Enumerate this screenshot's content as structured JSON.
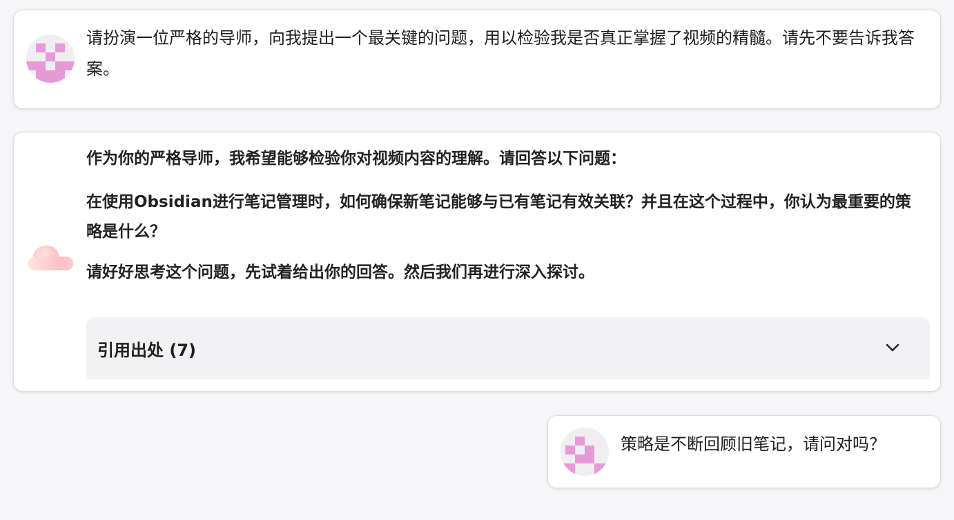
{
  "messages": {
    "user1": {
      "text": "请扮演一位严格的导师，向我提出一个最关键的问题，用以检验我是否真正掌握了视频的精髓。请先不要告诉我答案。"
    },
    "assistant": {
      "paragraphs": [
        "作为你的严格导师，我希望能够检验你对视频内容的理解。请回答以下问题：",
        "在使用Obsidian进行笔记管理时，如何确保新笔记能够与已有笔记有效关联？并且在这个过程中，你认为最重要的策略是什么？",
        "请好好思考这个问题，先试着给出你的回答。然后我们再进行深入探讨。"
      ],
      "citations_label": "引用出处 (7)",
      "citations_icon": "chevron-down-icon"
    },
    "user2": {
      "text": "策略是不断回顾旧笔记，请问对吗？"
    }
  },
  "colors": {
    "avatar_pixel": "#e79ad8",
    "card_border": "#dedede",
    "citations_bg": "#f2f2f4"
  }
}
